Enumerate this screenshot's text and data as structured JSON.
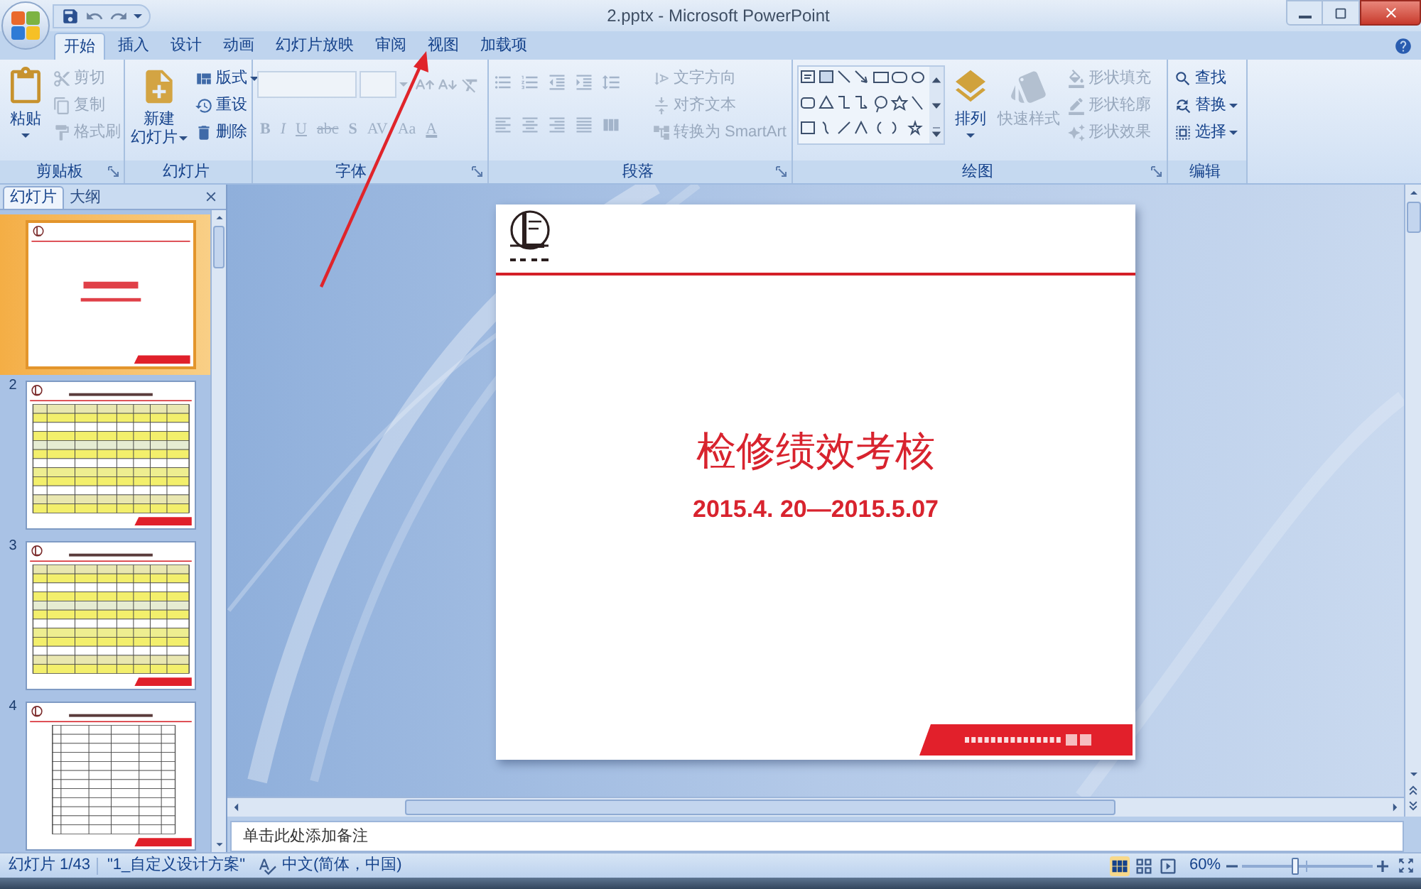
{
  "window": {
    "title": "2.pptx - Microsoft PowerPoint"
  },
  "tabs": [
    {
      "label": "开始",
      "selected": true
    },
    {
      "label": "插入",
      "selected": false
    },
    {
      "label": "设计",
      "selected": false
    },
    {
      "label": "动画",
      "selected": false
    },
    {
      "label": "幻灯片放映",
      "selected": false
    },
    {
      "label": "审阅",
      "selected": false
    },
    {
      "label": "视图",
      "selected": false
    },
    {
      "label": "加载项",
      "selected": false
    }
  ],
  "ribbon": {
    "groups": [
      {
        "kind": "clipboard",
        "label": "剪贴板",
        "main": {
          "label": "粘贴",
          "disabled": false,
          "dropdown": true
        },
        "items": [
          {
            "label": "剪切",
            "disabled": true,
            "dropdown": false
          },
          {
            "label": "复制",
            "disabled": true,
            "dropdown": false
          },
          {
            "label": "格式刷",
            "disabled": true,
            "dropdown": false
          }
        ]
      },
      {
        "kind": "slides",
        "label": "幻灯片",
        "main": {
          "lines": [
            "新建",
            "幻灯片"
          ],
          "disabled": false,
          "dropdown": true
        },
        "items": [
          {
            "label": "版式",
            "disabled": false,
            "dropdown": true
          },
          {
            "label": "重设",
            "disabled": false,
            "dropdown": false
          },
          {
            "label": "删除",
            "disabled": false,
            "dropdown": false
          }
        ]
      },
      {
        "kind": "font",
        "label": "字体",
        "disabled": true,
        "buttons": [
          "B",
          "I",
          "U",
          "abc",
          "S",
          "AV",
          "Aa",
          "A"
        ]
      },
      {
        "kind": "paragraph",
        "label": "段落",
        "disabled": true,
        "items": [
          {
            "label": "文字方向",
            "disabled": true,
            "dropdown": false
          },
          {
            "label": "对齐文本",
            "disabled": true,
            "dropdown": false
          },
          {
            "label": "转换为 SmartArt",
            "disabled": true,
            "dropdown": false
          }
        ]
      },
      {
        "kind": "drawing",
        "label": "绘图",
        "main": {
          "label": "排列",
          "disabled": false,
          "dropdown": true
        },
        "quick_styles": {
          "label": "快速样式",
          "disabled": true,
          "dropdown": false
        },
        "items": [
          {
            "label": "形状填充",
            "disabled": true,
            "dropdown": false
          },
          {
            "label": "形状轮廓",
            "disabled": true,
            "dropdown": false
          },
          {
            "label": "形状效果",
            "disabled": true,
            "dropdown": false
          }
        ]
      },
      {
        "kind": "editing",
        "label": "编辑",
        "items": [
          {
            "label": "查找",
            "disabled": false,
            "dropdown": false
          },
          {
            "label": "替换",
            "disabled": false,
            "dropdown": true
          },
          {
            "label": "选择",
            "disabled": false,
            "dropdown": true
          }
        ]
      }
    ]
  },
  "slides_panel": {
    "tabs": [
      {
        "label": "幻灯片",
        "selected": true
      },
      {
        "label": "大纲",
        "selected": false
      }
    ],
    "thumbnails": [
      {
        "kind": "cover",
        "selected": true
      },
      {
        "number": "2",
        "kind": "shaded",
        "selected": false
      },
      {
        "number": "3",
        "kind": "shaded",
        "selected": false
      },
      {
        "number": "4",
        "kind": "grid",
        "selected": false
      }
    ]
  },
  "slide": {
    "title": "检修绩效考核",
    "subtitle": "2015.4. 20—2015.5.07"
  },
  "notes": {
    "placeholder": "单击此处添加备注"
  },
  "status_bar": {
    "slide_counter": "幻灯片 1/43",
    "theme": "\"1_自定义设计方案\"",
    "language": "中文(简体，中国)",
    "views": [
      {
        "kind": "normal",
        "selected": true
      },
      {
        "kind": "sorter",
        "selected": false
      },
      {
        "kind": "show",
        "selected": false
      }
    ],
    "zoom": "60%",
    "zoom_slider": {
      "level": 0.4
    }
  }
}
